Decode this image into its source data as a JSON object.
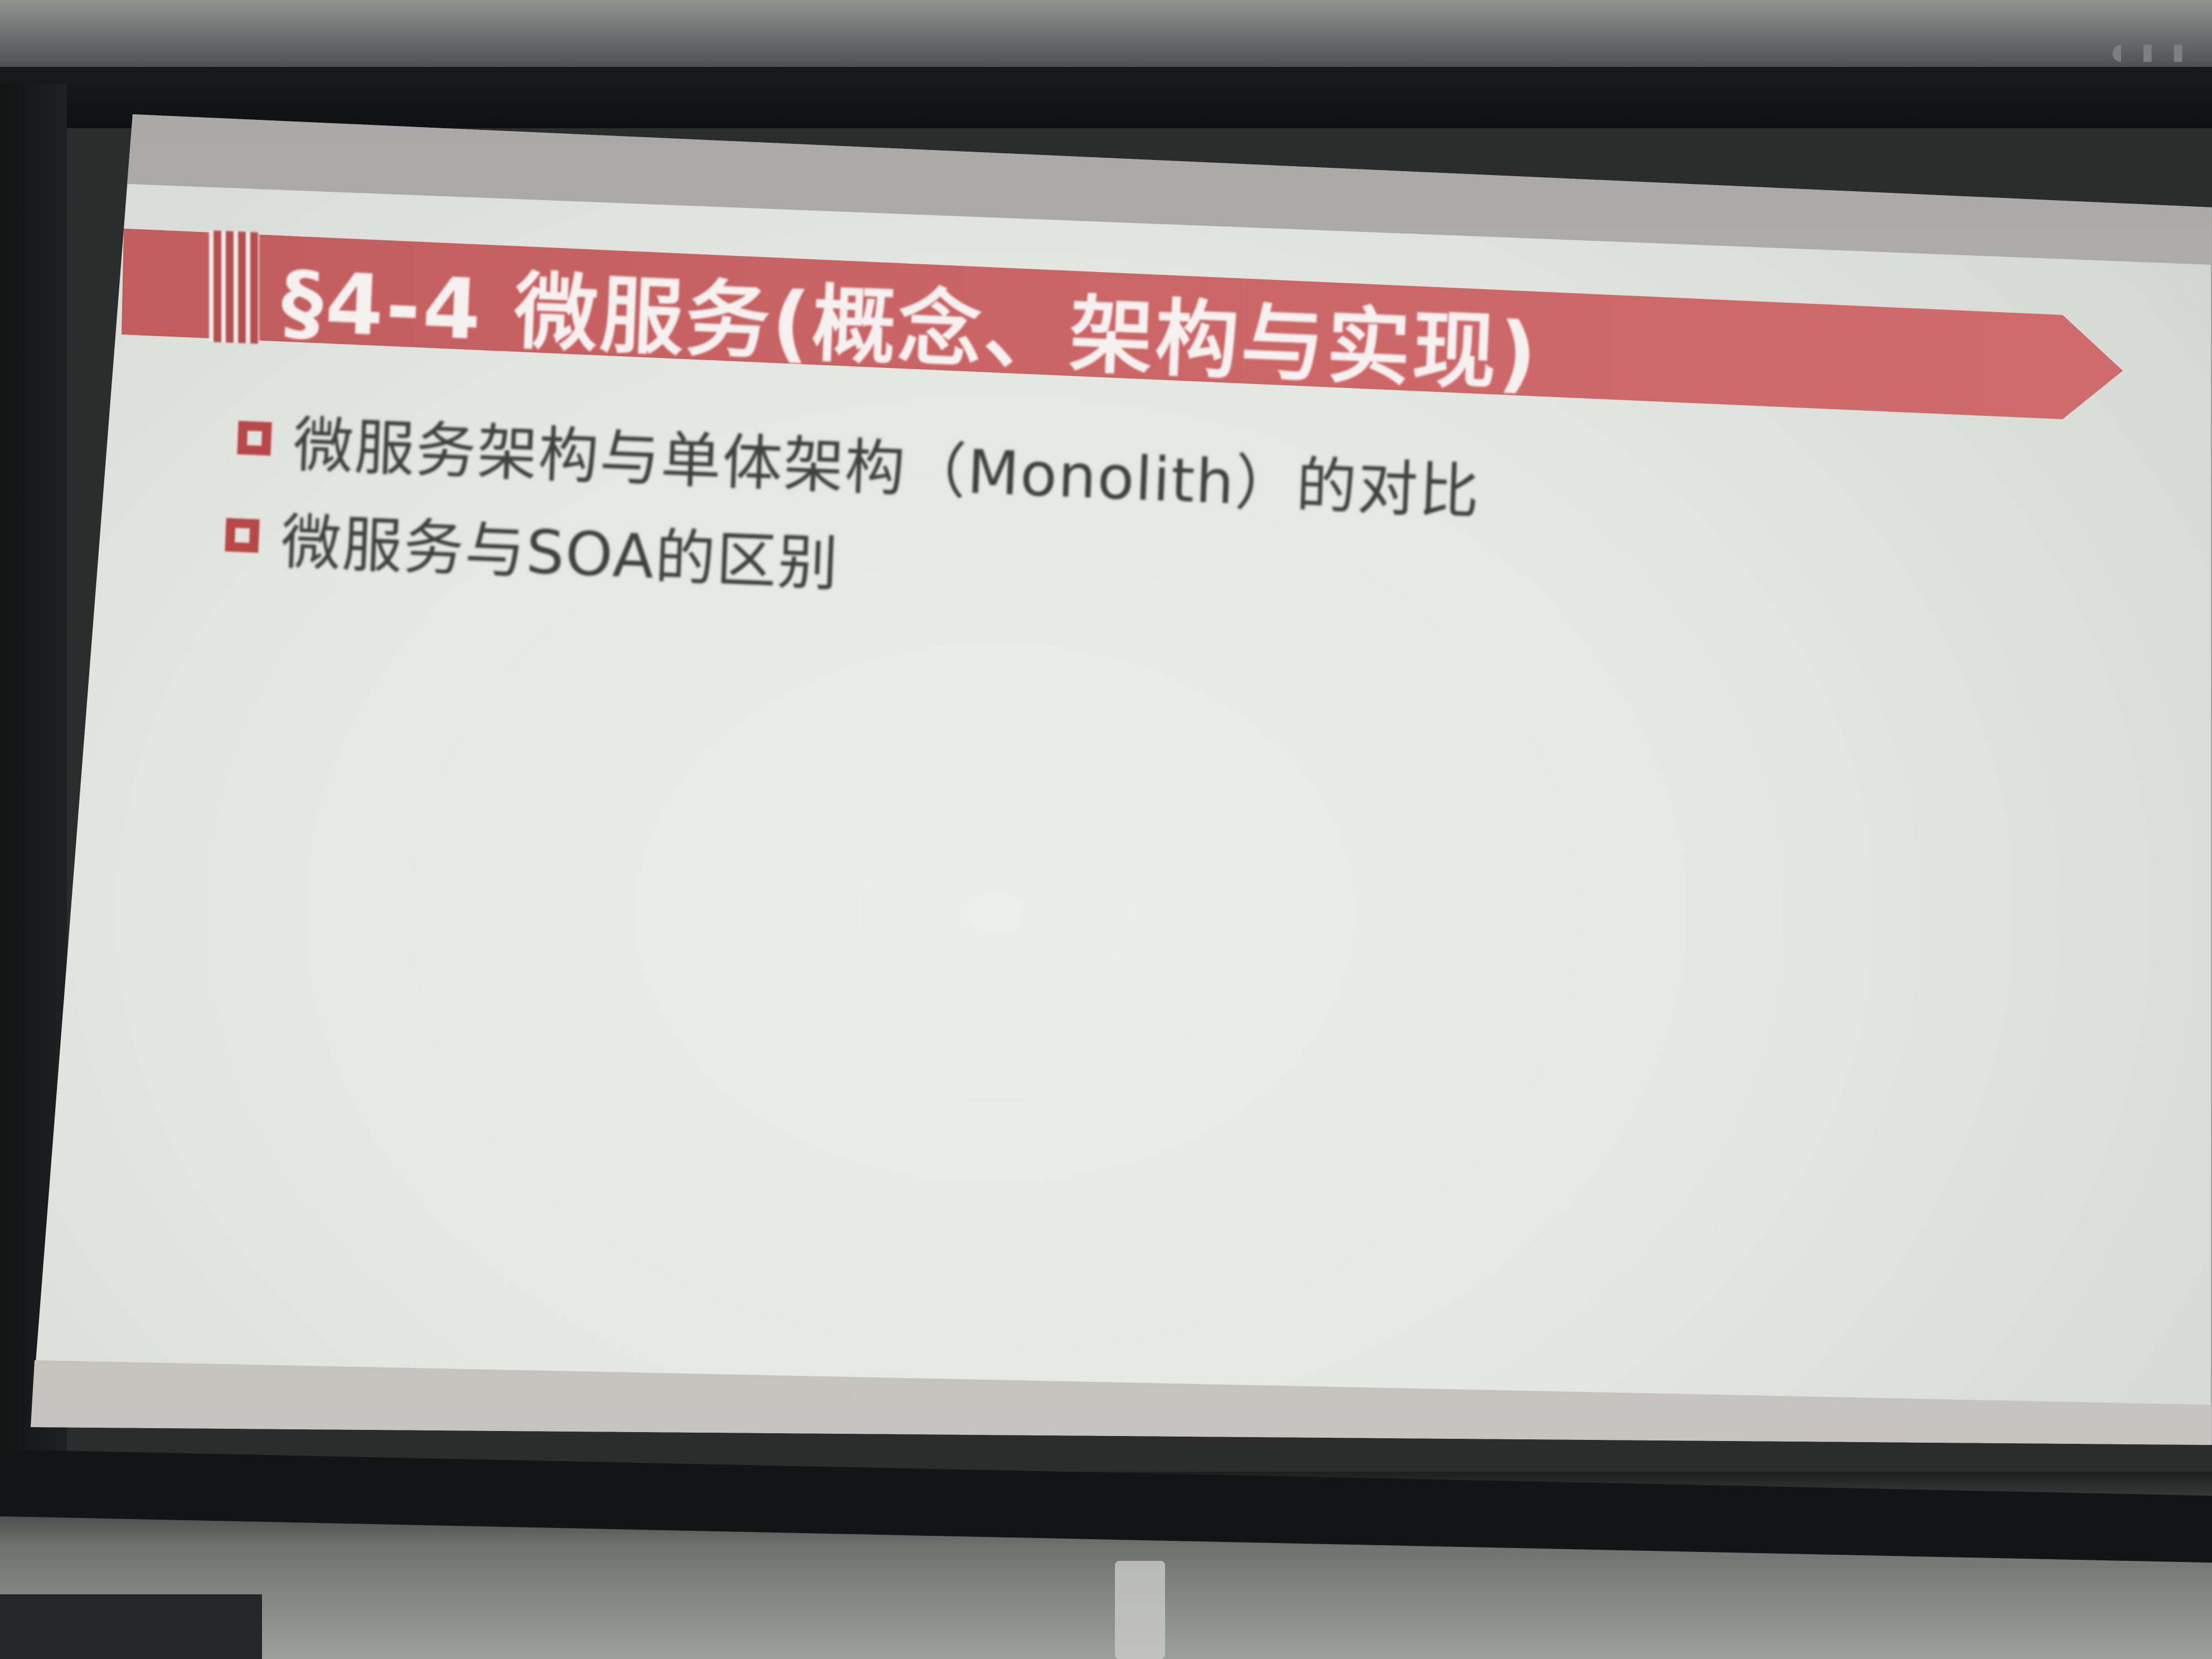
{
  "slide": {
    "title": "§4-4 微服务(概念、架构与实现)",
    "bullets": [
      {
        "text": "微服务架构与单体架构（Monolith）的对比"
      },
      {
        "text": "微服务与SOA的区别"
      }
    ]
  },
  "colors": {
    "banner": "#cc6565",
    "bullet_box": "#b84848",
    "slide_background": "#e4e7e2",
    "frame": "#121414"
  }
}
